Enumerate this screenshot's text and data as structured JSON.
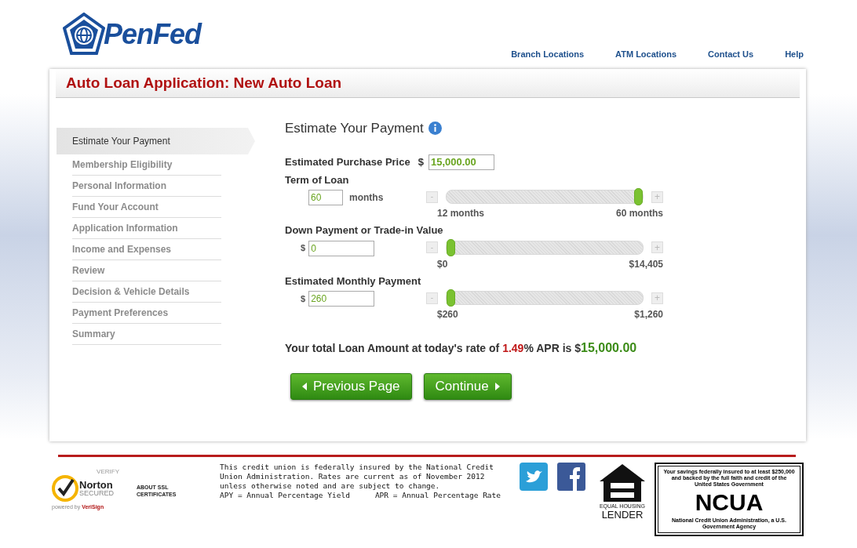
{
  "header": {
    "logo_text": "PenFed",
    "nav": [
      "Branch Locations",
      "ATM Locations",
      "Contact Us",
      "Help"
    ]
  },
  "title": "Auto Loan Application: New Auto Loan",
  "steps": [
    {
      "label": "Estimate Your Payment",
      "selected": true
    },
    {
      "label": "Membership Eligibility",
      "selected": false
    },
    {
      "label": "Personal Information",
      "selected": false
    },
    {
      "label": "Fund Your Account",
      "selected": false
    },
    {
      "label": "Application Information",
      "selected": false
    },
    {
      "label": "Income and Expenses",
      "selected": false
    },
    {
      "label": "Review",
      "selected": false
    },
    {
      "label": "Decision & Vehicle Details",
      "selected": false
    },
    {
      "label": "Payment Preferences",
      "selected": false
    },
    {
      "label": "Summary",
      "selected": false
    }
  ],
  "form": {
    "heading": "Estimate Your Payment",
    "purchase_price": {
      "label": "Estimated Purchase Price",
      "currency": "$",
      "value": "15,000.00"
    },
    "sliders": [
      {
        "label": "Term of Loan",
        "value": "60",
        "unit": "months",
        "level": 1,
        "min_label": "12 months",
        "max_label": "60 months",
        "minus": "-",
        "plus": "+"
      },
      {
        "label": "Down Payment or Trade-in Value",
        "currency": "$",
        "value": "0",
        "level": 0,
        "min_label": "$0",
        "max_label": "$14,405",
        "minus": "-",
        "plus": "+"
      },
      {
        "label": "Estimated Monthly Payment",
        "currency": "$",
        "value": "260",
        "level": 0,
        "min_label": "$260",
        "max_label": "$1,260",
        "minus": "-",
        "plus": "+"
      }
    ],
    "total": {
      "before": "Your total Loan Amount at today's rate of ",
      "rate": "1.49",
      "middle": "% APR is $",
      "amount": "15,000.00"
    },
    "buttons": [
      {
        "label": "Previous Page",
        "kind": "back"
      },
      {
        "label": "Continue",
        "kind": "next"
      }
    ]
  },
  "footer": {
    "norton": {
      "verify": "VERIFY",
      "brand": "Norton",
      "secured": "SECURED",
      "powered_prefix": "powered by ",
      "powered_brand": "VeriSign"
    },
    "ssl_link": "ABOUT SSL CERTIFICATES",
    "disclaimer": "This credit union is federally insured by the National Credit Union Administration. Rates are current as of November 2012 unless otherwise noted and are subject to change.",
    "apy": "APY = Annual Percentage Yield",
    "apr": "APR = Annual Percentage Rate",
    "equal_housing": {
      "line1": "EQUAL HOUSING",
      "line2": "LENDER"
    },
    "ncua": {
      "top": "Your savings federally insured to at least $250,000 and backed by the full faith and credit of the United States Government",
      "name": "NCUA",
      "bottom": "National Credit Union Administration, a U.S. Government Agency"
    }
  }
}
